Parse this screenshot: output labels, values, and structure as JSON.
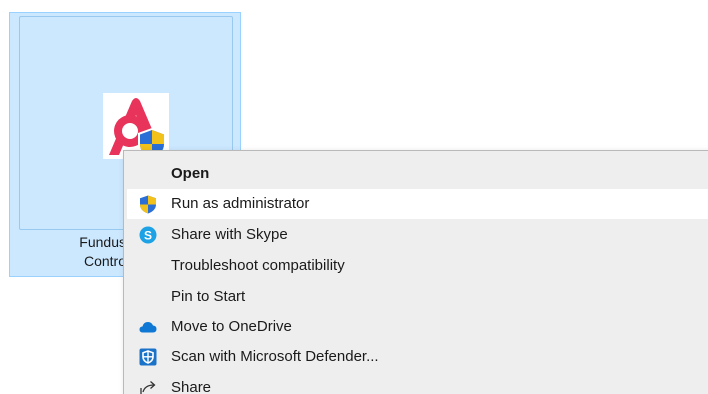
{
  "file_tile": {
    "name_line1": "Fundus",
    "name_line2": "Contro"
  },
  "context_menu": {
    "items": [
      {
        "label": "Open",
        "icon": "none",
        "bold": true
      },
      {
        "label": "Run as administrator",
        "icon": "uac-shield-icon",
        "highlighted": true
      },
      {
        "label": "Share with Skype",
        "icon": "skype-icon"
      },
      {
        "label": "Troubleshoot compatibility",
        "icon": "none"
      },
      {
        "label": "Pin to Start",
        "icon": "none"
      },
      {
        "label": "Move to OneDrive",
        "icon": "onedrive-cloud-icon"
      },
      {
        "label": "Scan with Microsoft Defender...",
        "icon": "defender-shield-icon"
      },
      {
        "label": "Share",
        "icon": "share-icon"
      }
    ]
  },
  "colors": {
    "selection_fill": "#cce8ff",
    "selection_border": "#99d1ff",
    "menu_background": "#eeeeee",
    "menu_highlight": "#ffffff",
    "app_brand": "#e8335a",
    "skype_blue": "#1ea2e6",
    "onedrive_blue": "#0f78d4",
    "defender_blue": "#1a73c8"
  }
}
